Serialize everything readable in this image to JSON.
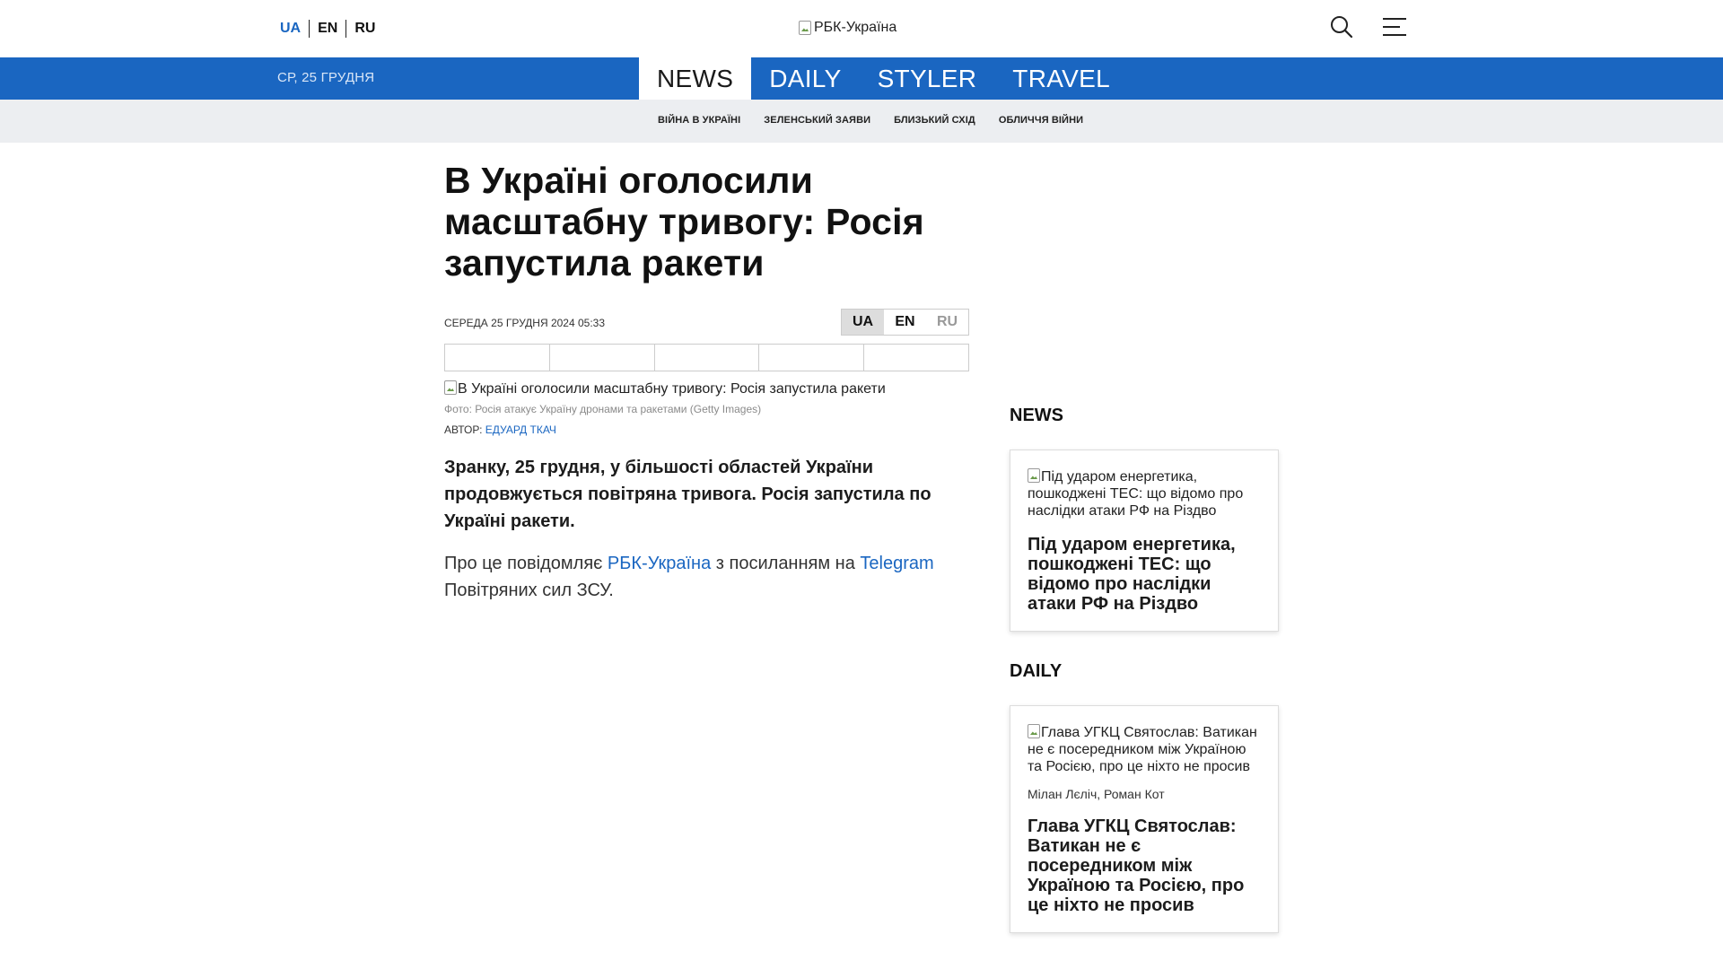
{
  "header": {
    "languages": [
      "UA",
      "EN",
      "RU"
    ],
    "logo_alt": "РБК-Україна"
  },
  "nav": {
    "date": "СР, 25 ГРУДНЯ",
    "sections": [
      "NEWS",
      "DAILY",
      "STYLER",
      "TRAVEL"
    ],
    "active_section": "NEWS"
  },
  "subnav": {
    "items": [
      "ВІЙНА В УКРАЇНІ",
      "ЗЕЛЕНСЬКИЙ ЗАЯВИ",
      "БЛИЗЬКИЙ СХІД",
      "ОБЛИЧЧЯ ВІЙНИ"
    ]
  },
  "article": {
    "title": "В Україні оголосили масштабну тривогу: Росія запустила ракети",
    "date": "СЕРЕДА 25 ГРУДНЯ 2024 05:33",
    "languages": [
      "UA",
      "EN",
      "RU"
    ],
    "photo_alt": "В Україні оголосили масштабну тривогу: Росія запустила ракети",
    "photo_caption": "Фото: Росія атакує Україну дронами та ракетами (Getty Images)",
    "author_label": "АВТОР:",
    "author_name": "ЕДУАРД ТКАЧ",
    "lead": "Зранку, 25 грудня, у більшості областей України продовжується повітряна тривога. Росія запустила по Україні ракети.",
    "para_text_1": "Про це повідомляє ",
    "para_link_1": "РБК-Україна",
    "para_text_2": " з посиланням на ",
    "para_link_2": "Telegram",
    "para_text_3": " Повітряних сил ЗСУ."
  },
  "sidebar": {
    "news_title": "NEWS",
    "news_card": {
      "img_alt": "Під ударом енергетика, пошкоджені ТЕС: що відомо про наслідки атаки РФ на Різдво",
      "title": "Під ударом енергетика, пошкоджені ТЕС: що відомо про наслідки атаки РФ на Різдво"
    },
    "daily_title": "DAILY",
    "daily_card": {
      "img_alt": "Глава УГКЦ Святослав: Ватикан не є посередником між Україною та Росією, про це ніхто не просив",
      "authors": "Мілан Лєліч, Роман Кот",
      "title": "Глава УГКЦ Святослав: Ватикан не є посередником між Україною та Росією, про це ніхто не просив"
    }
  },
  "colors": {
    "brand_blue": "#1a66c1",
    "subnav_bg": "#eceef1"
  },
  "icons": [
    "search-icon",
    "menu-icon",
    "broken-image-icon"
  ]
}
